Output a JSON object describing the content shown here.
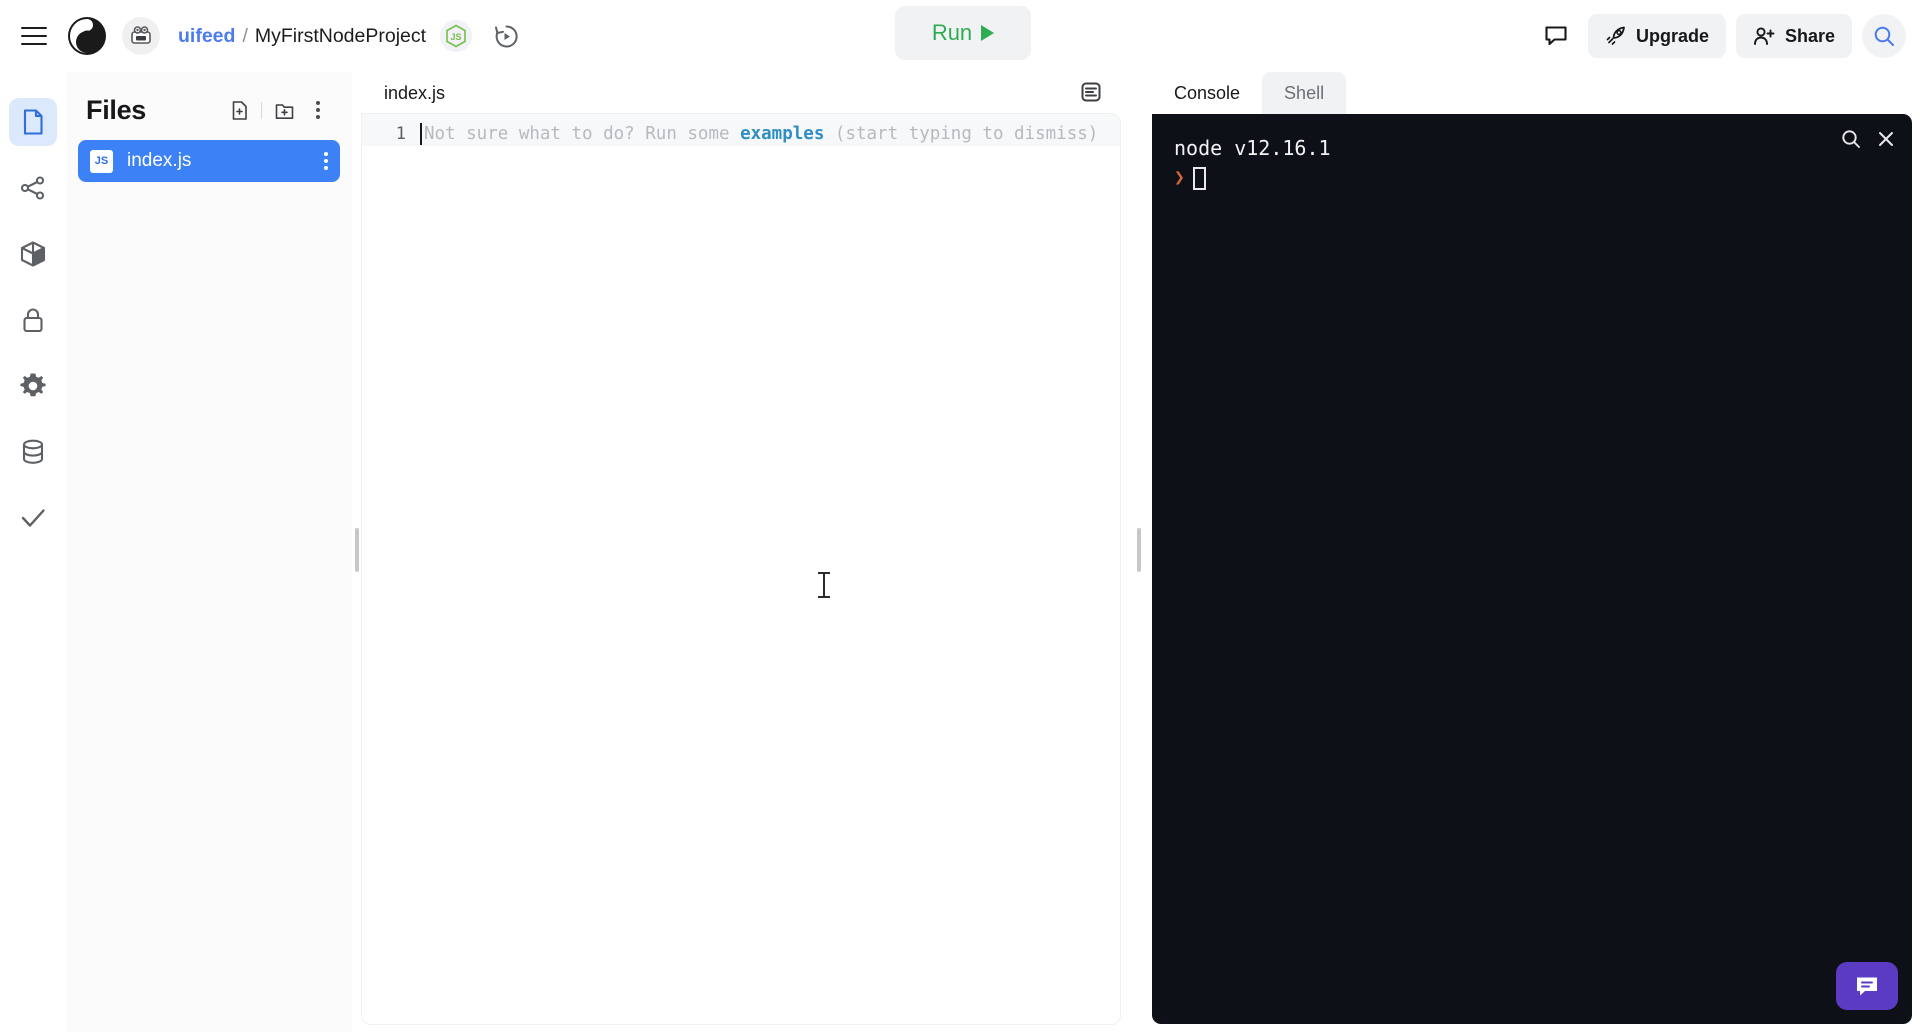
{
  "header": {
    "menu_icon": "hamburger-menu-icon",
    "logo_icon": "replit-logo-icon",
    "avatar_icon": "user-avatar-icon",
    "breadcrumb": {
      "owner": "uifeed",
      "separator": "/",
      "project": "MyFirstNodeProject"
    },
    "language_badge_icon": "nodejs-badge-icon",
    "history_icon": "version-history-icon",
    "run_button": {
      "label": "Run",
      "icon": "play-triangle-icon",
      "text_color": "#2eac52",
      "bg_color": "#f1f2f3"
    },
    "chat_icon": "comment-bubble-icon",
    "upgrade_button": {
      "label": "Upgrade",
      "icon": "rocket-icon"
    },
    "share_button": {
      "label": "Share",
      "icon": "person-add-icon"
    },
    "search_icon": "search-icon"
  },
  "rail": {
    "items": [
      {
        "name": "files",
        "icon": "file-icon",
        "active": true
      },
      {
        "name": "version-control",
        "icon": "git-branch-icon",
        "active": false
      },
      {
        "name": "packages",
        "icon": "package-cube-icon",
        "active": false
      },
      {
        "name": "secrets",
        "icon": "lock-icon",
        "active": false
      },
      {
        "name": "settings",
        "icon": "gear-icon",
        "active": false
      },
      {
        "name": "database",
        "icon": "database-icon",
        "active": false
      },
      {
        "name": "unit-tests",
        "icon": "checkmark-icon",
        "active": false
      }
    ],
    "active_color": "#dce8fb",
    "active_icon_color": "#3c81f6",
    "help_button": {
      "label": "?",
      "icon": "question-mark-icon"
    }
  },
  "files_panel": {
    "title": "Files",
    "new_file_icon": "new-file-icon",
    "new_folder_icon": "new-folder-icon",
    "more_icon": "kebab-menu-icon",
    "files": [
      {
        "name": "index.js",
        "badge": "JS",
        "selected": true
      }
    ],
    "selected_color": "#3c81f6"
  },
  "editor": {
    "tabs": [
      {
        "label": "index.js",
        "active": true
      }
    ],
    "format_icon": "format-lines-icon",
    "line_number": "1",
    "placeholder": {
      "prefix": "Not sure what to do? Run some ",
      "link": "examples",
      "suffix": " (start typing to dismiss)"
    },
    "cursor_icon": "text-ibeam-cursor"
  },
  "console": {
    "tabs": [
      {
        "label": "Console",
        "active": true
      },
      {
        "label": "Shell",
        "active": false
      }
    ],
    "search_icon": "search-icon",
    "close_icon": "close-x-icon",
    "output": "node v12.16.1",
    "prompt_symbol": "❯",
    "bg_color": "#0e1018",
    "prompt_color": "#d2663a"
  },
  "chat_widget": {
    "icon": "chat-bubble-icon",
    "bg_color": "#5b3bc4"
  }
}
